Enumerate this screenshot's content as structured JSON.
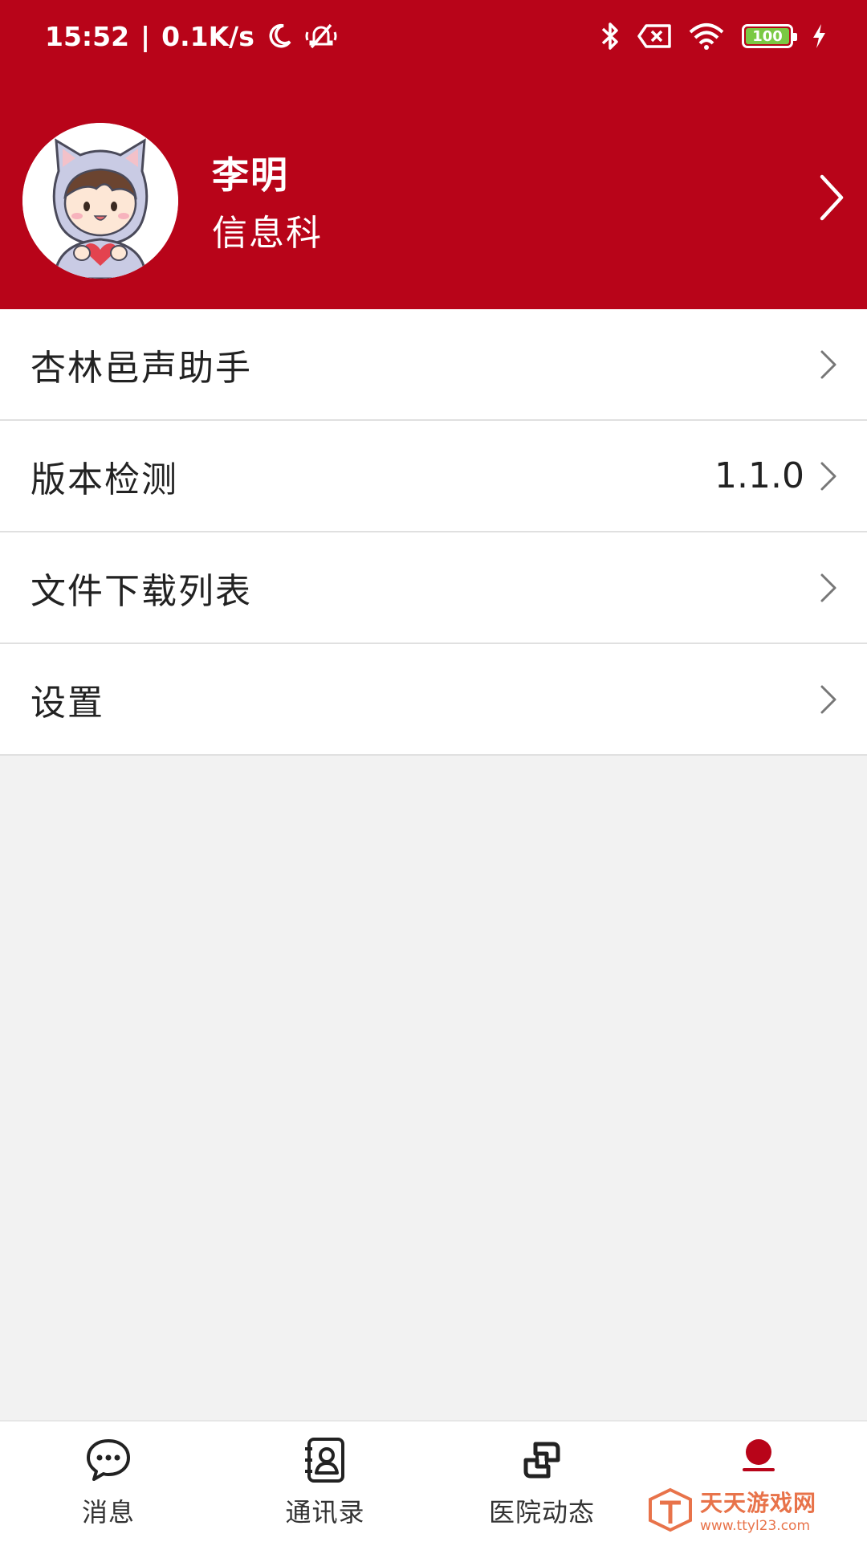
{
  "status_bar": {
    "time": "15:52",
    "separator": "|",
    "net_speed": "0.1K/s",
    "battery": "100"
  },
  "profile": {
    "name": "李明",
    "department": "信息科"
  },
  "menu": [
    {
      "label": "杏林邑声助手",
      "value": ""
    },
    {
      "label": "版本检测",
      "value": "1.1.0"
    },
    {
      "label": "文件下载列表",
      "value": ""
    },
    {
      "label": "设置",
      "value": ""
    }
  ],
  "bottom_nav": [
    {
      "label": "消息"
    },
    {
      "label": "通讯录"
    },
    {
      "label": "医院动态"
    },
    {
      "label": "我的"
    }
  ],
  "watermark": {
    "title": "天天游戏网",
    "url": "www.ttyl23.com"
  },
  "colors": {
    "brand_red": "#b80419",
    "background": "#f2f2f2",
    "battery_green": "#7ac943"
  }
}
